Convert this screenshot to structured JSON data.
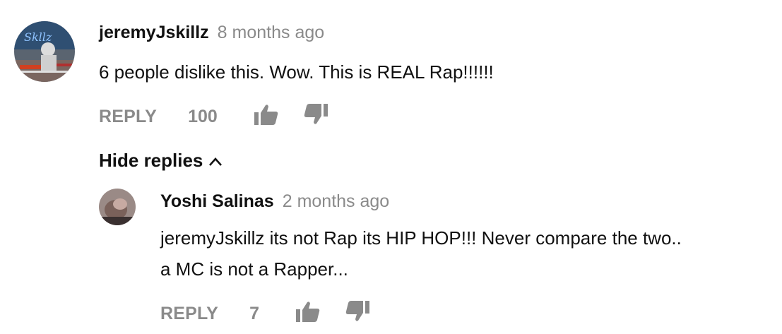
{
  "comments": [
    {
      "author": "jeremyJskillz",
      "time": "8 months ago",
      "text_lines": [
        "6 people dislike this. Wow. This is REAL Rap!!!!!!"
      ],
      "reply_label": "REPLY",
      "likes": "100",
      "avatar_icon": "avatar-jeremyjskillz"
    }
  ],
  "hide_replies_label": "Hide replies",
  "replies": [
    {
      "author": "Yoshi Salinas",
      "time": "2 months ago",
      "text_lines": [
        "jeremyJskillz its not Rap its HIP HOP!!! Never compare the two..",
        "a MC is not a Rapper..."
      ],
      "reply_label": "REPLY",
      "likes": "7",
      "avatar_icon": "avatar-yoshi-salinas"
    }
  ],
  "colors": {
    "text": "#111111",
    "muted": "#8a8a8a"
  }
}
